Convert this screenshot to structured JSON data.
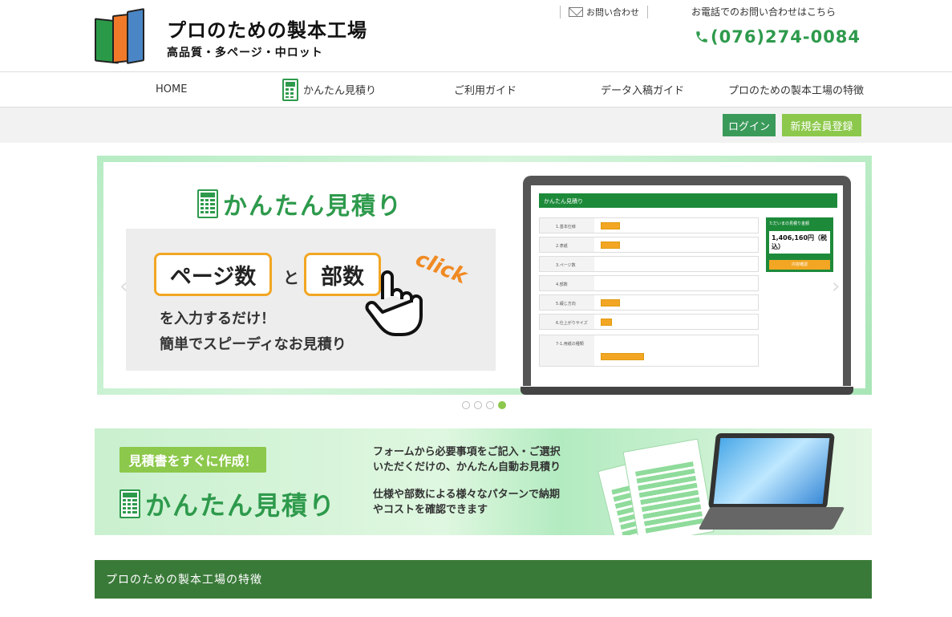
{
  "header": {
    "logo_title": "プロのための製本工場",
    "logo_sub": "高品質・多ページ・中ロット",
    "contact_label": "お問い合わせ",
    "tel_label": "お電話でのお問い合わせはこちら",
    "tel": "(076)274-0084"
  },
  "nav": {
    "items": [
      {
        "label": "HOME"
      },
      {
        "label": "かんたん見積り"
      },
      {
        "label": "ご利用ガイド"
      },
      {
        "label": "データ入稿ガイド"
      },
      {
        "label": "プロのための製本工場の特徴"
      }
    ]
  },
  "auth": {
    "login": "ログイン",
    "register": "新規会員登録"
  },
  "slider": {
    "title": "かんたん見積り",
    "pill1": "ページ数",
    "and": "と",
    "pill2": "部数",
    "click": "click",
    "line1": "を入力するだけ！",
    "line2": "簡単でスピーディなお見積り",
    "screen_title": "かんたん見積り",
    "screen_rows": [
      "1.基本仕様",
      "2.表紙",
      "3.ページ数",
      "4.部数",
      "5.綴じ方向",
      "6.仕上がりサイズ",
      "7-1.用紙の種類"
    ],
    "screen_price_label": "ただいまの見積り金額",
    "screen_price": "1,406,160円（税込）",
    "screen_btn": "内容確認",
    "dots": 4,
    "active_dot": 4,
    "prev": "‹",
    "next": "›"
  },
  "banner": {
    "tag": "見積書をすぐに作成！",
    "title": "かんたん見積り",
    "text1a": "フォームから必要事項をご記入・ご選択",
    "text1b": "いただくだけの、かんたん自動お見積り",
    "text2a": "仕様や部数による様々なパターンで納期",
    "text2b": "やコストを確認できます"
  },
  "section": {
    "title": "プロのための製本工場の特徴"
  },
  "colors": {
    "brand_green": "#2e9a4c",
    "light_green": "#8cc84b",
    "section_green": "#3a7a39",
    "orange": "#f2a623"
  }
}
